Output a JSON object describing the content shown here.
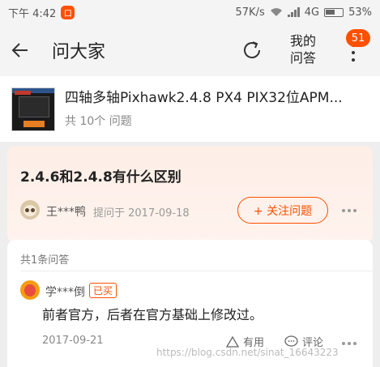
{
  "status_bar": {
    "time": "下午 4:42",
    "app_badge": "口",
    "network_speed": "57K/s",
    "network_type": "4G",
    "battery": "53%"
  },
  "header": {
    "title": "问大家",
    "my_questions": "我的\n问答",
    "notification_count": "51"
  },
  "product": {
    "name": "四轴多轴Pixhawk2.4.8 PX4 PIX32位APM...",
    "question_count": "共 10个 问题"
  },
  "question": {
    "title": "2.4.6和2.4.8有什么区别",
    "asker": "王***鸭",
    "asked_on": "提问于 2017-09-18",
    "follow_label": "+ 关注问题"
  },
  "answers": {
    "count_label": "共1条问答",
    "items": [
      {
        "author": "学***倒",
        "badge": "已买",
        "text": "前者官方，后者在官方基础上修改过。",
        "date": "2017-09-21",
        "useful_label": "有用",
        "comment_label": "评论"
      }
    ]
  },
  "watermark": "https://blog.csdn.net/sinat_16643223",
  "colors": {
    "accent": "#ff5000",
    "question_card_bg": "#fdeee6"
  }
}
